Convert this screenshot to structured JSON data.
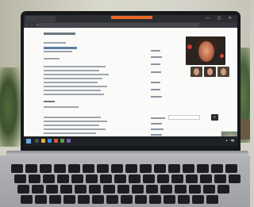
{
  "browser": {
    "tabs": [
      "",
      "",
      "",
      "",
      ""
    ],
    "address": ""
  },
  "page": {
    "title": "",
    "section_heading": "",
    "search_placeholder": ""
  },
  "video_call": {
    "participants_visible": 4
  },
  "colors": {
    "active_tab": "#e46a2a",
    "bezel": "#17181b",
    "taskbar": "#1e2126",
    "laptop_body": "#a9abae"
  },
  "icons": [
    "search-icon",
    "windows-start-icon",
    "webcam-thumbnail-icon"
  ]
}
